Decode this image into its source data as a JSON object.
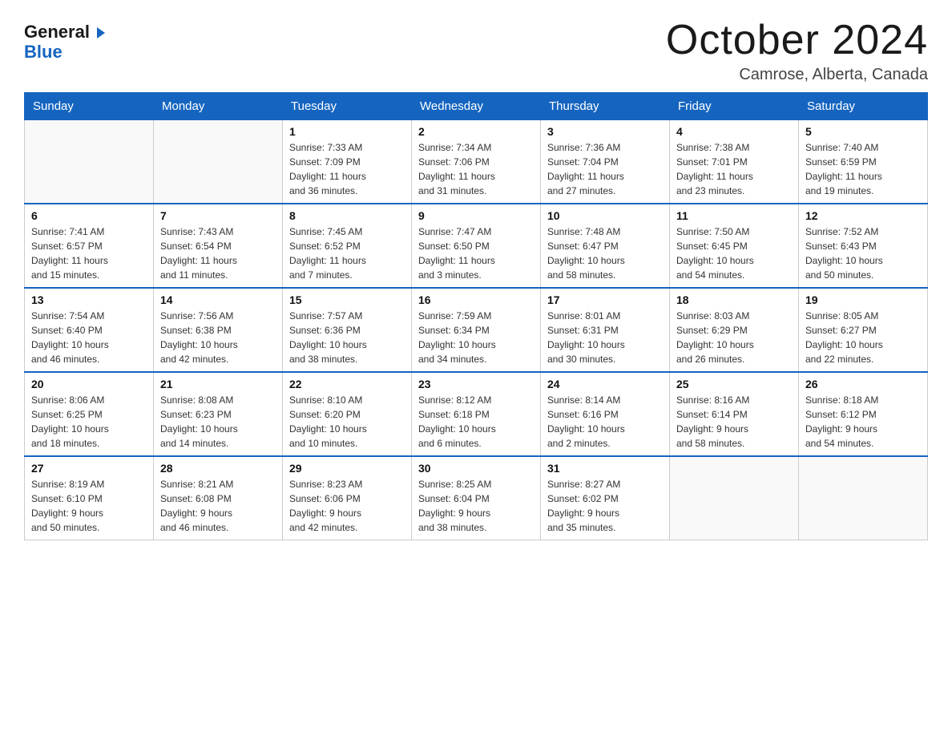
{
  "logo": {
    "general": "General",
    "blue": "Blue"
  },
  "header": {
    "month": "October 2024",
    "location": "Camrose, Alberta, Canada"
  },
  "weekdays": [
    "Sunday",
    "Monday",
    "Tuesday",
    "Wednesday",
    "Thursday",
    "Friday",
    "Saturday"
  ],
  "weeks": [
    [
      {
        "day": "",
        "info": ""
      },
      {
        "day": "",
        "info": ""
      },
      {
        "day": "1",
        "info": "Sunrise: 7:33 AM\nSunset: 7:09 PM\nDaylight: 11 hours\nand 36 minutes."
      },
      {
        "day": "2",
        "info": "Sunrise: 7:34 AM\nSunset: 7:06 PM\nDaylight: 11 hours\nand 31 minutes."
      },
      {
        "day": "3",
        "info": "Sunrise: 7:36 AM\nSunset: 7:04 PM\nDaylight: 11 hours\nand 27 minutes."
      },
      {
        "day": "4",
        "info": "Sunrise: 7:38 AM\nSunset: 7:01 PM\nDaylight: 11 hours\nand 23 minutes."
      },
      {
        "day": "5",
        "info": "Sunrise: 7:40 AM\nSunset: 6:59 PM\nDaylight: 11 hours\nand 19 minutes."
      }
    ],
    [
      {
        "day": "6",
        "info": "Sunrise: 7:41 AM\nSunset: 6:57 PM\nDaylight: 11 hours\nand 15 minutes."
      },
      {
        "day": "7",
        "info": "Sunrise: 7:43 AM\nSunset: 6:54 PM\nDaylight: 11 hours\nand 11 minutes."
      },
      {
        "day": "8",
        "info": "Sunrise: 7:45 AM\nSunset: 6:52 PM\nDaylight: 11 hours\nand 7 minutes."
      },
      {
        "day": "9",
        "info": "Sunrise: 7:47 AM\nSunset: 6:50 PM\nDaylight: 11 hours\nand 3 minutes."
      },
      {
        "day": "10",
        "info": "Sunrise: 7:48 AM\nSunset: 6:47 PM\nDaylight: 10 hours\nand 58 minutes."
      },
      {
        "day": "11",
        "info": "Sunrise: 7:50 AM\nSunset: 6:45 PM\nDaylight: 10 hours\nand 54 minutes."
      },
      {
        "day": "12",
        "info": "Sunrise: 7:52 AM\nSunset: 6:43 PM\nDaylight: 10 hours\nand 50 minutes."
      }
    ],
    [
      {
        "day": "13",
        "info": "Sunrise: 7:54 AM\nSunset: 6:40 PM\nDaylight: 10 hours\nand 46 minutes."
      },
      {
        "day": "14",
        "info": "Sunrise: 7:56 AM\nSunset: 6:38 PM\nDaylight: 10 hours\nand 42 minutes."
      },
      {
        "day": "15",
        "info": "Sunrise: 7:57 AM\nSunset: 6:36 PM\nDaylight: 10 hours\nand 38 minutes."
      },
      {
        "day": "16",
        "info": "Sunrise: 7:59 AM\nSunset: 6:34 PM\nDaylight: 10 hours\nand 34 minutes."
      },
      {
        "day": "17",
        "info": "Sunrise: 8:01 AM\nSunset: 6:31 PM\nDaylight: 10 hours\nand 30 minutes."
      },
      {
        "day": "18",
        "info": "Sunrise: 8:03 AM\nSunset: 6:29 PM\nDaylight: 10 hours\nand 26 minutes."
      },
      {
        "day": "19",
        "info": "Sunrise: 8:05 AM\nSunset: 6:27 PM\nDaylight: 10 hours\nand 22 minutes."
      }
    ],
    [
      {
        "day": "20",
        "info": "Sunrise: 8:06 AM\nSunset: 6:25 PM\nDaylight: 10 hours\nand 18 minutes."
      },
      {
        "day": "21",
        "info": "Sunrise: 8:08 AM\nSunset: 6:23 PM\nDaylight: 10 hours\nand 14 minutes."
      },
      {
        "day": "22",
        "info": "Sunrise: 8:10 AM\nSunset: 6:20 PM\nDaylight: 10 hours\nand 10 minutes."
      },
      {
        "day": "23",
        "info": "Sunrise: 8:12 AM\nSunset: 6:18 PM\nDaylight: 10 hours\nand 6 minutes."
      },
      {
        "day": "24",
        "info": "Sunrise: 8:14 AM\nSunset: 6:16 PM\nDaylight: 10 hours\nand 2 minutes."
      },
      {
        "day": "25",
        "info": "Sunrise: 8:16 AM\nSunset: 6:14 PM\nDaylight: 9 hours\nand 58 minutes."
      },
      {
        "day": "26",
        "info": "Sunrise: 8:18 AM\nSunset: 6:12 PM\nDaylight: 9 hours\nand 54 minutes."
      }
    ],
    [
      {
        "day": "27",
        "info": "Sunrise: 8:19 AM\nSunset: 6:10 PM\nDaylight: 9 hours\nand 50 minutes."
      },
      {
        "day": "28",
        "info": "Sunrise: 8:21 AM\nSunset: 6:08 PM\nDaylight: 9 hours\nand 46 minutes."
      },
      {
        "day": "29",
        "info": "Sunrise: 8:23 AM\nSunset: 6:06 PM\nDaylight: 9 hours\nand 42 minutes."
      },
      {
        "day": "30",
        "info": "Sunrise: 8:25 AM\nSunset: 6:04 PM\nDaylight: 9 hours\nand 38 minutes."
      },
      {
        "day": "31",
        "info": "Sunrise: 8:27 AM\nSunset: 6:02 PM\nDaylight: 9 hours\nand 35 minutes."
      },
      {
        "day": "",
        "info": ""
      },
      {
        "day": "",
        "info": ""
      }
    ]
  ]
}
